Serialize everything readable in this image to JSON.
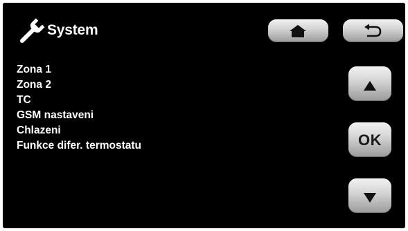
{
  "header": {
    "title": "System",
    "icon": "wrench-icon"
  },
  "menu": {
    "items": [
      {
        "label": "Zona 1"
      },
      {
        "label": "Zona 2"
      },
      {
        "label": "TC"
      },
      {
        "label": "GSM nastaveni"
      },
      {
        "label": "Chlazeni"
      },
      {
        "label": "Funkce difer. termostatu"
      }
    ]
  },
  "nav": {
    "home_icon": "home-icon",
    "back_icon": "back-arrow-icon",
    "up_icon": "up-triangle-icon",
    "ok_label": "OK",
    "down_icon": "down-triangle-icon"
  },
  "colors": {
    "background": "#000000",
    "text": "#ffffff",
    "button": "#d6d6d6",
    "icon": "#111111"
  }
}
